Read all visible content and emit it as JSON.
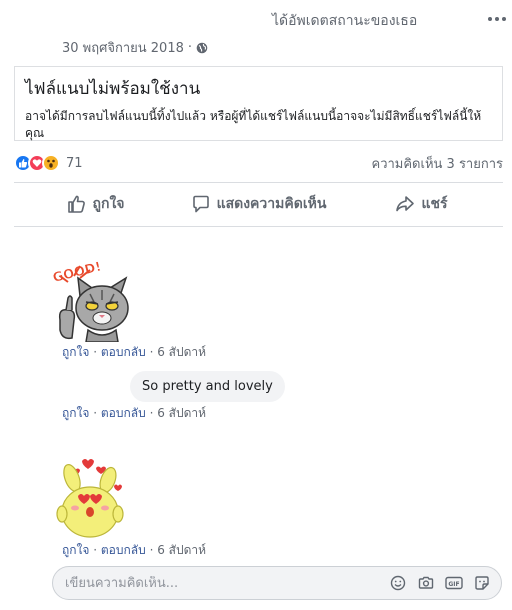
{
  "header": {
    "status_text": "ได้อัพเดตสถานะของเธอ",
    "timestamp": "30 พฤศจิกายน 2018",
    "privacy_icon": "globe-icon",
    "more_icon": "more-options-icon"
  },
  "attachment": {
    "title": "ไฟล์แนบไม่พร้อมใช้งาน",
    "description": "อาจได้มีการลบไฟล์แนบนี้ทิ้งไปแล้ว หรือผู้ที่ได้แชร์ไฟล์แนบนี้อาจจะไม่มีสิทธิ์แชร์ไฟล์นี้ให้คุณ"
  },
  "stats": {
    "reactions": [
      "like",
      "love",
      "wow"
    ],
    "reaction_count": "71",
    "comment_count": "ความคิดเห็น 3 รายการ"
  },
  "actions": {
    "like_label": "ถูกใจ",
    "comment_label": "แสดงความคิดเห็น",
    "share_label": "แชร์"
  },
  "comments": [
    {
      "type": "sticker",
      "sticker_name": "good-cat-sticker",
      "sticker_text": "GOOD!",
      "like": "ถูกใจ",
      "reply": "ตอบกลับ",
      "time": "6 สัปดาห์"
    },
    {
      "type": "text",
      "text": "So pretty and lovely",
      "like": "ถูกใจ",
      "reply": "ตอบกลับ",
      "time": "6 สัปดาห์"
    },
    {
      "type": "sticker",
      "sticker_name": "love-bunny-sticker",
      "like": "ถูกใจ",
      "reply": "ตอบกลับ",
      "time": "6 สัปดาห์"
    }
  ],
  "composer": {
    "placeholder": "เขียนความคิดเห็น...",
    "icons": [
      "emoji-icon",
      "camera-icon",
      "gif-icon",
      "sticker-icon"
    ]
  },
  "colors": {
    "link": "#385898",
    "muted": "#616770",
    "like_blue": "#1877f2",
    "love_red": "#f33e58",
    "wow_yellow": "#f7b125"
  }
}
